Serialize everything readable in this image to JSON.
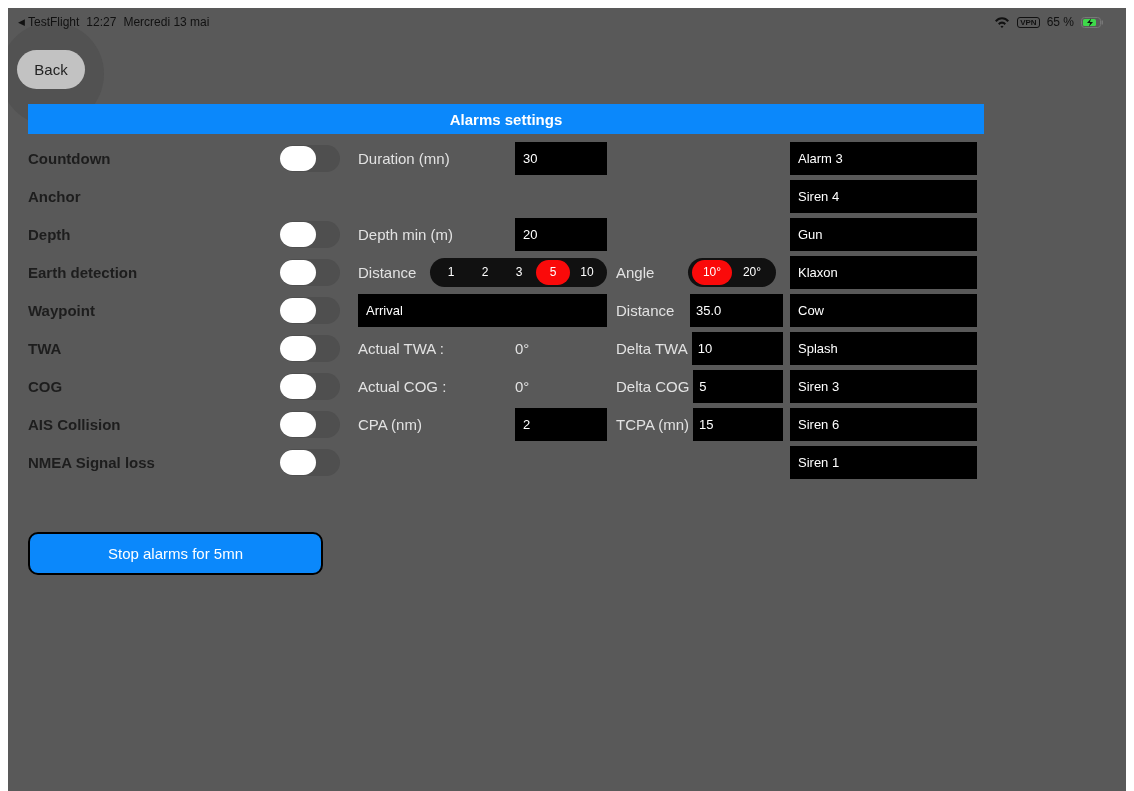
{
  "status_bar": {
    "back_glyph": "◀",
    "app": "TestFlight",
    "time": "12:27",
    "date": "Mercredi 13 mai",
    "vpn": "VPN",
    "battery": "65 %"
  },
  "back_button": {
    "label": "Back"
  },
  "title": "Alarms settings",
  "rows": [
    {
      "label": "Countdown",
      "toggle": {
        "on": false
      },
      "middle": {
        "kind": "field",
        "label": "Duration (mn)",
        "value": "30"
      },
      "sound": "Alarm 3"
    },
    {
      "label": "Anchor",
      "sound": "Siren 4"
    },
    {
      "label": "Depth",
      "toggle": {
        "on": false
      },
      "middle": {
        "kind": "field",
        "label": "Depth min (m)",
        "value": "20"
      },
      "sound": "Gun"
    },
    {
      "label": "Earth detection",
      "toggle": {
        "on": false
      },
      "middle": {
        "kind": "segmented",
        "label": "Distance",
        "options": [
          {
            "label": "1",
            "selected": false
          },
          {
            "label": "2",
            "selected": false
          },
          {
            "label": "3",
            "selected": false
          },
          {
            "label": "5",
            "selected": true
          },
          {
            "label": "10",
            "selected": false
          }
        ]
      },
      "extra": {
        "kind": "segmented",
        "label": "Angle",
        "options": [
          {
            "label": "10°",
            "selected": true
          },
          {
            "label": "20°",
            "selected": false
          }
        ]
      },
      "sound": "Klaxon"
    },
    {
      "label": "Waypoint",
      "toggle": {
        "on": false
      },
      "middle": {
        "kind": "wide_field",
        "value": "Arrival"
      },
      "extra": {
        "kind": "field",
        "label": "Distance",
        "value": "35.0"
      },
      "sound": "Cow"
    },
    {
      "label": "TWA",
      "toggle": {
        "on": false
      },
      "middle": {
        "kind": "reading",
        "label": "Actual TWA :",
        "value": "0°"
      },
      "extra": {
        "kind": "field",
        "label": "Delta TWA",
        "value": "10"
      },
      "sound": "Splash"
    },
    {
      "label": "COG",
      "toggle": {
        "on": false
      },
      "middle": {
        "kind": "reading",
        "label": "Actual COG :",
        "value": "0°"
      },
      "extra": {
        "kind": "field",
        "label": "Delta COG",
        "value": "5"
      },
      "sound": "Siren 3"
    },
    {
      "label": "AIS Collision",
      "toggle": {
        "on": false
      },
      "middle": {
        "kind": "field",
        "label": "CPA (nm)",
        "value": "2"
      },
      "extra": {
        "kind": "field",
        "label": "TCPA (mn)",
        "value": "15"
      },
      "sound": "Siren 6"
    },
    {
      "label": "NMEA Signal loss",
      "toggle": {
        "on": false
      },
      "sound": "Siren 1"
    }
  ],
  "stop_button": {
    "label": "Stop alarms for 5mn"
  }
}
